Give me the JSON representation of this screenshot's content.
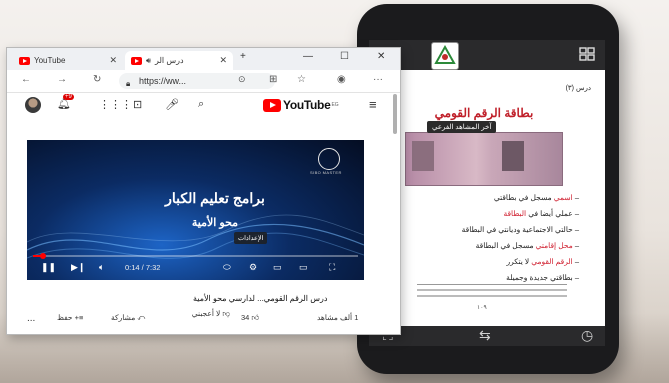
{
  "browser": {
    "tabs": [
      {
        "label": "YouTube",
        "active": false
      },
      {
        "label": "درس الر",
        "active": true
      }
    ],
    "url": "https://ww...",
    "new_tab": "+",
    "window_controls": {
      "minimize": "—",
      "maximize": "☐",
      "close": "✕"
    }
  },
  "youtube": {
    "logo_text": "YouTube",
    "logo_sup": "EG",
    "notification_count": "+9",
    "video": {
      "overlay_title": "برامج تعليم الكبار",
      "overlay_subtitle": "محو الأمية",
      "settings_chip": "الإعدادات",
      "brand_sub": "SIBO MASTER",
      "current_time": "0:14 / 7:32",
      "progress_fraction": 0.03
    },
    "title": "درس الرقم القومي... لدارسي محو الأمية",
    "views": "1 ألف مشاهد",
    "like_count": "34",
    "dislike_label": "لا أعجبني",
    "share_label": "مشاركة",
    "save_label": "حفظ",
    "more_label": "..."
  },
  "phone": {
    "lesson_label": "درس (٣)",
    "lesson_title": "بطاقة الرقم القومي",
    "tooltip": "آخر المشاهد الفرعي",
    "bullets": [
      {
        "pre": "– ",
        "red": "اسمي",
        "post": " مسجل في بطاقتي"
      },
      {
        "pre": "– عملي أيضا في ",
        "red": "البطاقة",
        "post": ""
      },
      {
        "pre": "– حالتي الاجتماعية وديانتي في البطاقة",
        "red": "",
        "post": ""
      },
      {
        "pre": "– ",
        "red": "محل إقامتي",
        "post": " مسجل في البطاقة"
      },
      {
        "pre": "– ",
        "red": "الرقم القومي",
        "post": " لا يتكرر"
      },
      {
        "pre": "– بطاقتي جديدة وجميلة",
        "red": "",
        "post": ""
      }
    ],
    "page_number": "١٠٩"
  }
}
